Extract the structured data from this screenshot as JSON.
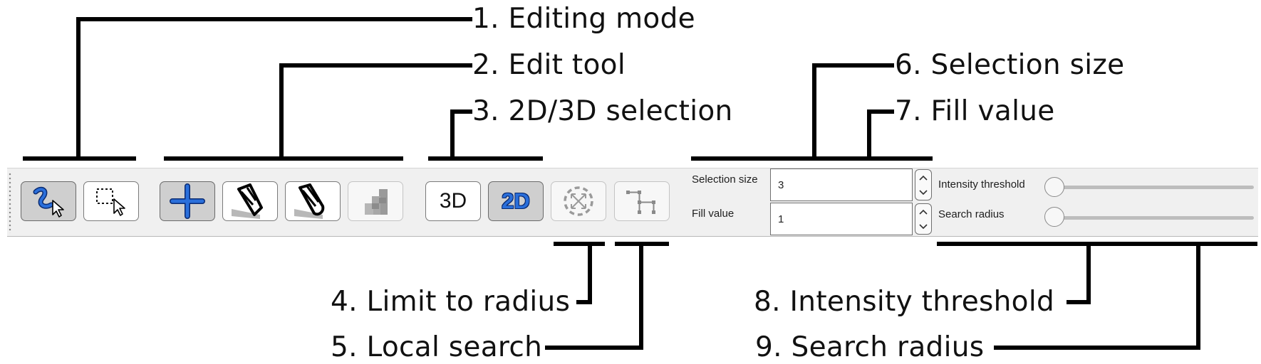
{
  "callouts": {
    "c1": "1. Editing mode",
    "c2": "2. Edit tool",
    "c3": "3. 2D/3D selection",
    "c4": "4. Limit to radius",
    "c5": "5. Local search",
    "c6": "6. Selection size",
    "c7": "7. Fill value",
    "c8": "8. Intensity threshold",
    "c9": "9. Search radius"
  },
  "toolbar": {
    "dim_3d": "3D",
    "dim_2d": "2D",
    "selection_size": {
      "label": "Selection size",
      "value": "3"
    },
    "fill_value": {
      "label": "Fill value",
      "value": "1"
    },
    "intensity_threshold": {
      "label": "Intensity threshold",
      "level": 0
    },
    "search_radius": {
      "label": "Search radius",
      "level": 0
    }
  },
  "icons": {
    "mode_freehand": "freehand-select-icon",
    "mode_box": "box-select-icon",
    "tool_add": "plus-icon",
    "tool_pen": "pen-icon",
    "tool_eraser": "eraser-icon",
    "tool_threshold": "staircase-icon",
    "limit_radius": "dashed-circle-icon",
    "local_search": "local-search-icon"
  },
  "colors": {
    "accent_blue": "#2a6fdb",
    "checked_bg": "#cfcfcf",
    "toolbar_bg": "#f0f0f0"
  }
}
